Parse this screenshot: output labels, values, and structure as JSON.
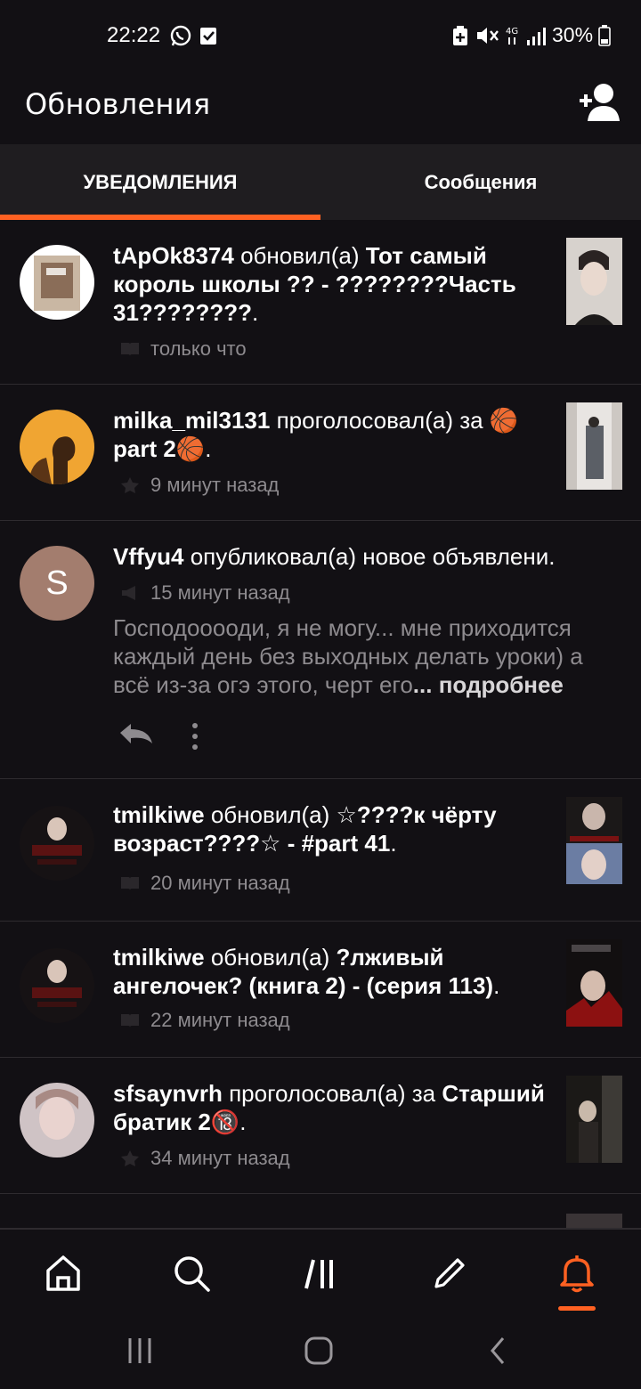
{
  "status_bar": {
    "time": "22:22",
    "battery": "30%"
  },
  "header": {
    "title": "Обновления"
  },
  "tabs": [
    {
      "label": "УВЕДОМЛЕНИЯ",
      "active": true
    },
    {
      "label": "Сообщения",
      "active": false
    }
  ],
  "colors": {
    "accent": "#ff6122",
    "background": "#121014",
    "muted_text": "#8e8b8f"
  },
  "notifications": [
    {
      "user": "tApOk8374",
      "action": "обновил(а)",
      "story": "Тот самый король школы ?? - ????????Часть 31????????",
      "end": ".",
      "time": "только что",
      "icon": "book-icon"
    },
    {
      "user": "milka_mil3131",
      "action": "проголосовал(а) за",
      "story": "🏀 part 2🏀",
      "end": ".",
      "time": "9 минут назад",
      "icon": "star-icon"
    },
    {
      "user": "Vffyu4",
      "action": "опубликовал(а) новое объявлени.",
      "avatar_letter": "S",
      "time": "15 минут назад",
      "icon": "megaphone-icon",
      "announcement": "Господооооди, я не могу... мне приходится каждый день без выходных делать уроки) а всё из-за огэ этого, черт его",
      "more": "... подробнее"
    },
    {
      "user": "tmilkiwe",
      "action": "обновил(а)",
      "story": "☆????к чёрту возраст????☆ - #part 41",
      "end": ".",
      "time": "20 минут назад",
      "icon": "book-icon"
    },
    {
      "user": "tmilkiwe",
      "action": "обновил(а)",
      "story": "?лживый ангелочек? (книга 2) - (серия 113)",
      "end": ".",
      "time": "22 минут назад",
      "icon": "book-icon"
    },
    {
      "user": "sfsaynvrh",
      "action": "проголосовал(а) за",
      "story": "Старший братик 2🔞",
      "end": ".",
      "time": "34 минут назад",
      "icon": "star-icon"
    }
  ],
  "bottom_nav": [
    "home-icon",
    "search-icon",
    "library-icon",
    "pencil-icon",
    "bell-icon"
  ]
}
